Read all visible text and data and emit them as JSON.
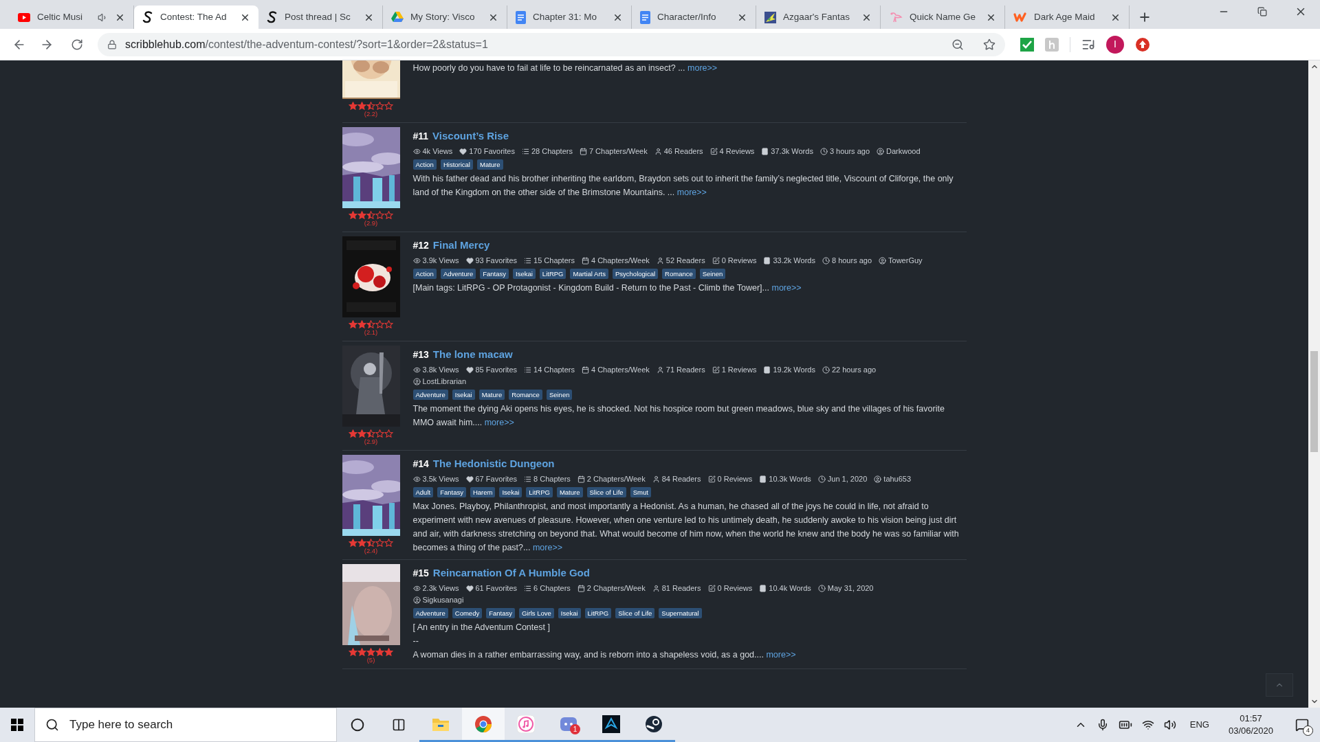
{
  "browser": {
    "tabs": [
      {
        "kind": "youtube",
        "title": "Celtic Musi",
        "selected": false,
        "audio": true
      },
      {
        "kind": "scribble",
        "title": "Contest: The Ad",
        "selected": true,
        "audio": false
      },
      {
        "kind": "scribble",
        "title": "Post thread | Sc",
        "selected": false,
        "audio": false
      },
      {
        "kind": "drive",
        "title": "My Story: Visco",
        "selected": false,
        "audio": false
      },
      {
        "kind": "docs",
        "title": "Chapter 31: Mo",
        "selected": false,
        "audio": false
      },
      {
        "kind": "docs",
        "title": "Character/Info",
        "selected": false,
        "audio": false
      },
      {
        "kind": "map",
        "title": "Azgaar's Fantas",
        "selected": false,
        "audio": false
      },
      {
        "kind": "bird",
        "title": "Quick Name Ge",
        "selected": false,
        "audio": false
      },
      {
        "kind": "wattpad",
        "title": "Dark Age Maid",
        "selected": false,
        "audio": false
      }
    ],
    "address": {
      "domain": "scribblehub.com",
      "path": "/contest/the-adventum-contest/?sort=1&order=2&status=1"
    },
    "profile_initial": "I"
  },
  "listings": [
    {
      "stars": 2.5,
      "rating": "(2.2)",
      "description": [
        "How poorly do you have to fail at life to be reincarnated as an insect? ..."
      ],
      "more": "more>>"
    },
    {
      "stars": 2.5,
      "rating": "(2.9)",
      "rank": "#11",
      "title": "Viscount’s Rise",
      "stat_rows": [
        [
          {
            "kind": "views",
            "text": "4k Views"
          },
          {
            "kind": "favorites",
            "text": "170 Favorites"
          },
          {
            "kind": "chapters",
            "text": "28 Chapters"
          },
          {
            "kind": "frequency",
            "text": "7 Chapters/Week"
          },
          {
            "kind": "readers",
            "text": "46 Readers"
          },
          {
            "kind": "reviews",
            "text": "4 Reviews"
          },
          {
            "kind": "words",
            "text": "37.3k Words"
          },
          {
            "kind": "updated",
            "text": "3 hours ago"
          },
          {
            "kind": "author",
            "text": "Darkwood"
          }
        ]
      ],
      "tags": [
        "Action",
        "Historical",
        "Mature"
      ],
      "description": [
        "With his father dead and his brother inheriting the earldom, Braydon sets out to inherit the family’s neglected title, Viscount of Cliforge, the only land of the Kingdom on the other side of the Brimstone Mountains. ..."
      ],
      "more": "more>>"
    },
    {
      "stars": 2.5,
      "rating": "(2.1)",
      "rank": "#12",
      "title": "Final Mercy",
      "stat_rows": [
        [
          {
            "kind": "views",
            "text": "3.9k Views"
          },
          {
            "kind": "favorites",
            "text": "93 Favorites"
          },
          {
            "kind": "chapters",
            "text": "15 Chapters"
          },
          {
            "kind": "frequency",
            "text": "4 Chapters/Week"
          },
          {
            "kind": "readers",
            "text": "52 Readers"
          },
          {
            "kind": "reviews",
            "text": "0 Reviews"
          },
          {
            "kind": "words",
            "text": "33.2k Words"
          },
          {
            "kind": "updated",
            "text": "8 hours ago"
          },
          {
            "kind": "author",
            "text": "TowerGuy"
          }
        ]
      ],
      "tags": [
        "Action",
        "Adventure",
        "Fantasy",
        "Isekai",
        "LitRPG",
        "Martial Arts",
        "Psychological",
        "Romance",
        "Seinen"
      ],
      "description": [
        "[Main tags: LitRPG - OP Protagonist - Kingdom Build - Return to the Past - Climb the Tower]..."
      ],
      "more": "more>>"
    },
    {
      "stars": 2.5,
      "rating": "(2.9)",
      "rank": "#13",
      "title": "The lone macaw",
      "stat_rows": [
        [
          {
            "kind": "views",
            "text": "3.8k Views"
          },
          {
            "kind": "favorites",
            "text": "85 Favorites"
          },
          {
            "kind": "chapters",
            "text": "14 Chapters"
          },
          {
            "kind": "frequency",
            "text": "4 Chapters/Week"
          },
          {
            "kind": "readers",
            "text": "71 Readers"
          },
          {
            "kind": "reviews",
            "text": "1 Reviews"
          },
          {
            "kind": "words",
            "text": "19.2k Words"
          },
          {
            "kind": "updated",
            "text": "22 hours ago"
          }
        ],
        [
          {
            "kind": "author",
            "text": "LostLibrarian"
          }
        ]
      ],
      "tags": [
        "Adventure",
        "Isekai",
        "Mature",
        "Romance",
        "Seinen"
      ],
      "description": [
        "The moment the dying Aki opens his eyes, he is shocked. Not his hospice room but green meadows, blue sky and the villages of his favorite MMO await him...."
      ],
      "more": "more>>"
    },
    {
      "stars": 2.5,
      "rating": "(2.4)",
      "rank": "#14",
      "title": "The Hedonistic Dungeon",
      "stat_rows": [
        [
          {
            "kind": "views",
            "text": "3.5k Views"
          },
          {
            "kind": "favorites",
            "text": "67 Favorites"
          },
          {
            "kind": "chapters",
            "text": "8 Chapters"
          },
          {
            "kind": "frequency",
            "text": "2 Chapters/Week"
          },
          {
            "kind": "readers",
            "text": "84 Readers"
          },
          {
            "kind": "reviews",
            "text": "0 Reviews"
          },
          {
            "kind": "words",
            "text": "10.3k Words"
          },
          {
            "kind": "updated",
            "text": "Jun 1, 2020"
          },
          {
            "kind": "author",
            "text": "tahu653"
          }
        ]
      ],
      "tags": [
        "Adult",
        "Fantasy",
        "Harem",
        "Isekai",
        "LitRPG",
        "Mature",
        "Slice of Life",
        "Smut"
      ],
      "description": [
        "Max Jones. Playboy, Philanthropist, and most importantly a Hedonist. As a human, he chased all of the joys he could in life, not afraid to experiment with new avenues of pleasure. However, when one venture led to his untimely death, he suddenly awoke to his vision being just dirt and air, with darkness stretching on beyond that. What would become of him now, when the world he knew and the body he was so familiar with becomes a thing of the past?..."
      ],
      "more": "more>>"
    },
    {
      "stars": 5,
      "rating": "(5)",
      "rank": "#15",
      "title": "Reincarnation Of A Humble God",
      "stat_rows": [
        [
          {
            "kind": "views",
            "text": "2.3k Views"
          },
          {
            "kind": "favorites",
            "text": "61 Favorites"
          },
          {
            "kind": "chapters",
            "text": "6 Chapters"
          },
          {
            "kind": "frequency",
            "text": "2 Chapters/Week"
          },
          {
            "kind": "readers",
            "text": "81 Readers"
          },
          {
            "kind": "reviews",
            "text": "0 Reviews"
          },
          {
            "kind": "words",
            "text": "10.4k Words"
          },
          {
            "kind": "updated",
            "text": "May 31, 2020"
          }
        ],
        [
          {
            "kind": "author",
            "text": "Sigkusanagi"
          }
        ]
      ],
      "tags": [
        "Adventure",
        "Comedy",
        "Fantasy",
        "Girls Love",
        "Isekai",
        "LitRPG",
        "Slice of Life",
        "Supernatural"
      ],
      "description": [
        "[ An entry in the Adventum Contest ]",
        "--",
        "A woman dies in a rather embarrassing way, and is reborn into a shapeless void, as a god...."
      ],
      "more": "more>>"
    }
  ],
  "taskbar": {
    "search_placeholder": "Type here to search",
    "apps": [
      {
        "kind": "explorer",
        "running": true,
        "selected": false
      },
      {
        "kind": "chrome",
        "running": true,
        "selected": true
      },
      {
        "kind": "music",
        "running": true,
        "selected": false
      },
      {
        "kind": "chat",
        "running": true,
        "selected": false,
        "badge": "1"
      },
      {
        "kind": "dark-app",
        "running": true,
        "selected": false
      },
      {
        "kind": "steam",
        "running": true,
        "selected": false
      }
    ],
    "language": "ENG",
    "time": "01:57",
    "date": "03/06/2020",
    "notifications": "4"
  }
}
